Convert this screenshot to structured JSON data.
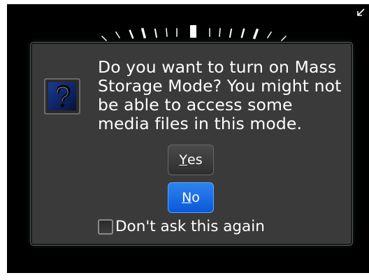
{
  "screen": {
    "corner_icon": "resize-arrow-icon",
    "indicator": "signal-dial-indicator"
  },
  "dialog": {
    "icon": "question-mark-icon",
    "message_lines": [
      "Do you want to turn on Mass",
      "Storage Mode? You might not",
      "be able to access some",
      "media files in this mode."
    ],
    "yes_button": {
      "mnemonic": "Y",
      "rest": "es"
    },
    "no_button": {
      "mnemonic": "N",
      "rest": "o",
      "focused": true
    },
    "dont_ask_label": "Don't ask this again",
    "dont_ask_checked": false
  },
  "colors": {
    "background": "#000000",
    "dialog": "#3a3a3a",
    "focus_blue": "#1a6de6",
    "text": "#ffffff"
  }
}
